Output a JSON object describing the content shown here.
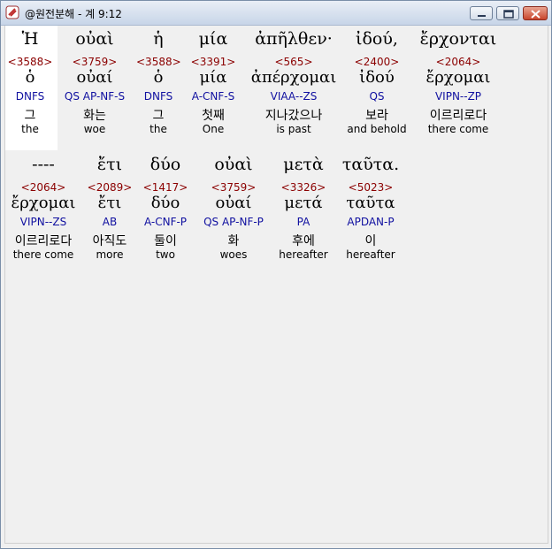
{
  "window": {
    "title": "@원전분해 - 계 9:12"
  },
  "rows": [
    {
      "words": [
        {
          "greek": "Ἡ",
          "strong": "<3588>",
          "lemma": "ὁ",
          "parse": "DNFS",
          "korean": "그",
          "english": "the"
        },
        {
          "greek": "οὐαὶ",
          "strong": "<3759>",
          "lemma": "οὐαί",
          "parse": "QS AP-NF-S",
          "korean": "화는",
          "english": "woe"
        },
        {
          "greek": "ἡ",
          "strong": "<3588>",
          "lemma": "ὁ",
          "parse": "DNFS",
          "korean": "그",
          "english": "the"
        },
        {
          "greek": "μία",
          "strong": "<3391>",
          "lemma": "μία",
          "parse": "A-CNF-S",
          "korean": "첫째",
          "english": "One"
        },
        {
          "greek": "ἀπῆλθεν·",
          "strong": "<565>",
          "lemma": "ἀπέρχομαι",
          "parse": "VIAA--ZS",
          "korean": "지나갔으나",
          "english": "is past"
        },
        {
          "greek": "ἰδού,",
          "strong": "<2400>",
          "lemma": "ἰδού",
          "parse": "QS",
          "korean": "보라",
          "english": "and behold"
        },
        {
          "greek": "ἔρχονται",
          "strong": "<2064>",
          "lemma": "ἔρχομαι",
          "parse": "VIPN--ZP",
          "korean": "이르리로다",
          "english": "there come"
        }
      ]
    },
    {
      "words": [
        {
          "greek": "----",
          "strong": "<2064>",
          "lemma": "ἔρχομαι",
          "parse": "VIPN--ZS",
          "korean": "이르리로다",
          "english": "there come"
        },
        {
          "greek": "ἔτι",
          "strong": "<2089>",
          "lemma": "ἔτι",
          "parse": "AB",
          "korean": "아직도",
          "english": "more"
        },
        {
          "greek": "δύο",
          "strong": "<1417>",
          "lemma": "δύο",
          "parse": "A-CNF-P",
          "korean": "둘이",
          "english": "two"
        },
        {
          "greek": "οὐαὶ",
          "strong": "<3759>",
          "lemma": "οὐαί",
          "parse": "QS AP-NF-P",
          "korean": "화",
          "english": "woes"
        },
        {
          "greek": "μετὰ",
          "strong": "<3326>",
          "lemma": "μετά",
          "parse": "PA",
          "korean": "후에",
          "english": "hereafter"
        },
        {
          "greek": "ταῦτα.",
          "strong": "<5023>",
          "lemma": "ταῦτα",
          "parse": "APDAN-P",
          "korean": "이",
          "english": "hereafter"
        }
      ]
    }
  ],
  "colors": {
    "strong": "#8b0000",
    "parse": "#1010a0",
    "selected_bg": "#ffffff"
  },
  "icons": [
    "app-icon",
    "minimize-icon",
    "maximize-icon",
    "close-icon"
  ]
}
